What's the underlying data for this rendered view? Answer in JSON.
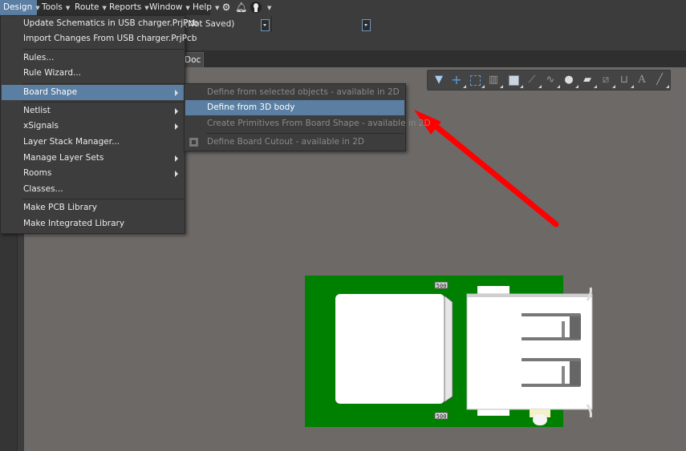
{
  "menubar": {
    "items": [
      {
        "label": "Design",
        "active": true
      },
      {
        "label": "Tools"
      },
      {
        "label": "Route"
      },
      {
        "label": "Reports"
      },
      {
        "label": "Window"
      },
      {
        "label": "Help"
      }
    ],
    "icons": [
      "gear-icon",
      "bell-icon",
      "user-icon"
    ]
  },
  "toolbar2": {
    "project_status_text": "(Not Saved)"
  },
  "document_tab": {
    "label": "Doc *"
  },
  "design_menu": {
    "items": [
      {
        "label": "Update Schematics in USB charger.PrjPcb"
      },
      {
        "label": "Import Changes From USB charger.PrjPcb"
      },
      {
        "label": "Rules..."
      },
      {
        "label": "Rule Wizard..."
      },
      {
        "label": "Board Shape",
        "submenu": true,
        "highlighted": true
      },
      {
        "label": "Netlist",
        "submenu": true
      },
      {
        "label": "xSignals",
        "submenu": true
      },
      {
        "label": "Layer Stack Manager..."
      },
      {
        "label": "Manage Layer Sets",
        "submenu": true
      },
      {
        "label": "Rooms",
        "submenu": true
      },
      {
        "label": "Classes..."
      },
      {
        "label": "Make PCB Library"
      },
      {
        "label": "Make Integrated Library"
      }
    ]
  },
  "board_shape_submenu": {
    "items": [
      {
        "label": "Define from selected objects - available in 2D",
        "enabled": false
      },
      {
        "label": "Define from 3D body",
        "enabled": true,
        "highlighted": true
      },
      {
        "label": "Create Primitives From Board Shape - available in 2D",
        "enabled": false
      },
      {
        "label": "Define Board Cutout - available in 2D",
        "enabled": false,
        "icon": "board-cutout-icon"
      }
    ]
  },
  "float_toolbar": {
    "icons": [
      "filter-icon",
      "cross-probe-icon",
      "select-rect-icon",
      "align-icon",
      "component-icon",
      "route-icon",
      "diff-pair-icon",
      "via-icon",
      "polygon-icon",
      "dimension-icon",
      "string-icon",
      "text-icon",
      "line-icon"
    ]
  },
  "pcb": {
    "component_labels": [
      "500",
      "500"
    ],
    "board_color": "#008000"
  },
  "annotation": {
    "color": "#ff0000"
  }
}
